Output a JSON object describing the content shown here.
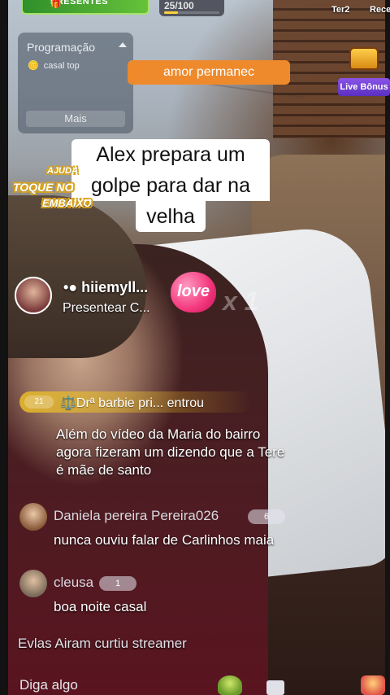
{
  "top": {
    "gift_banner": "PRESENTES",
    "progress_label": "25/100",
    "progress_fraction": 0.25,
    "tab_ter": "Ter2",
    "tab_rec": "Rece"
  },
  "programacao": {
    "title": "Programação",
    "item": "casal top",
    "more": "Mais"
  },
  "banner_orange": "amor permanec",
  "live_bonus": "Live Bônus",
  "caption": {
    "line1": "Alex prepara um",
    "line2": "golpe para dar na",
    "line3": "velha"
  },
  "help_badge": {
    "line1": "AJUDA",
    "line2": "TOQUE NO",
    "line3": "EMBAIXO"
  },
  "gift_notice": {
    "name": "•● hiiemyll...",
    "action": "Presentear C...",
    "gift": "love",
    "multiplier": "x 1"
  },
  "entry": {
    "level": "21",
    "text": "⚖️Drª barbie pri... entrou"
  },
  "messages": {
    "m1_line1": "Além do vídeo da Maria do bairro",
    "m1_line2": "agora fizeram um dizendo que a Tere",
    "m1_line3": "é mãe de santo"
  },
  "comments": [
    {
      "user": "Daniela pereira Pereira026",
      "level": "6",
      "text": "nunca ouviu falar de Carlinhos maia"
    },
    {
      "user": "cleusa",
      "level": "1",
      "text": "boa noite casal"
    }
  ],
  "liked_notice": "Evlas Airam curtiu streamer",
  "input_placeholder": "Diga algo",
  "colors": {
    "orange_banner": "#ee8a2c",
    "live_bonus": "#6a3ad6",
    "entry_gold": "#ebbe28",
    "love_pink": "#f3367b"
  }
}
